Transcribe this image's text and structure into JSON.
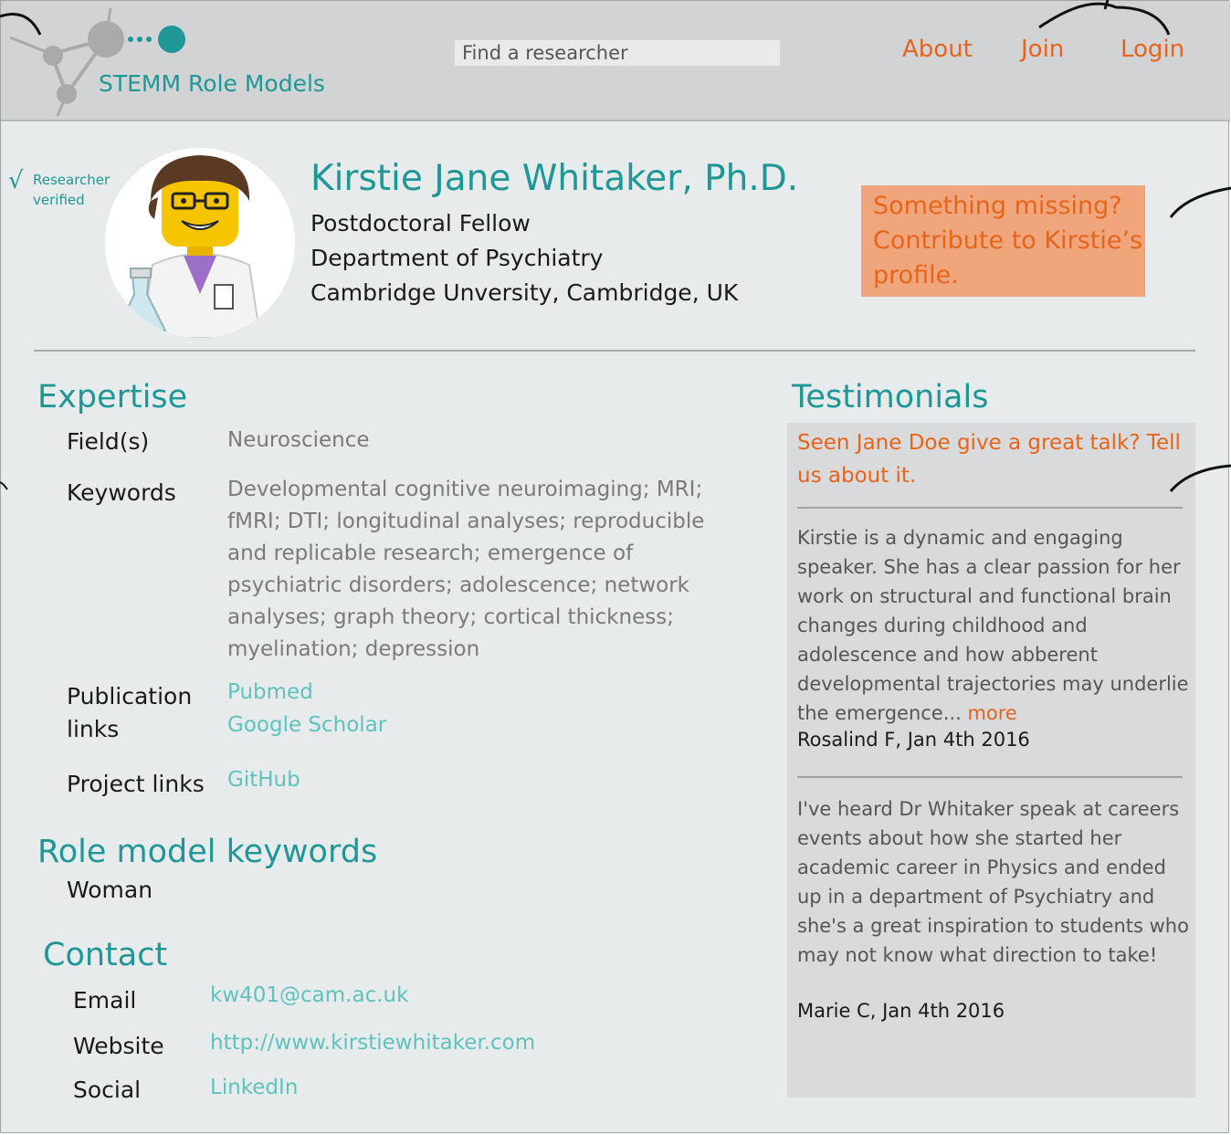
{
  "header": {
    "brand": "STEMM Role Models",
    "search_placeholder": "Find a researcher",
    "nav": {
      "about": "About",
      "join": "Join",
      "login": "Login"
    }
  },
  "profile": {
    "verified_label": "Researcher verified",
    "check_glyph": "√",
    "name": "Kirstie Jane Whitaker, Ph.D.",
    "position": "Postdoctoral Fellow",
    "department": "Department of Psychiatry",
    "institution": "Cambridge Unversity, Cambridge, UK",
    "contribute_text": "Something missing? Contribute to Kirstie’s profile."
  },
  "expertise": {
    "title": "Expertise",
    "fields_label": "Field(s)",
    "fields_value": "Neuroscience",
    "keywords_label": "Keywords",
    "keywords_value": "Developmental cognitive neuroimaging; MRI; fMRI; DTI; longitudinal analyses; reproducible and replicable research; emergence of psychiatric disorders; adolescence; network analyses; graph theory; cortical thickness; myelination; depression",
    "publication_label": "Publication links",
    "publication_links": [
      "Pubmed",
      "Google Scholar"
    ],
    "project_label": "Project links",
    "project_links": [
      "GitHub"
    ]
  },
  "role_model": {
    "title": "Role model keywords",
    "keywords": "Woman"
  },
  "contact": {
    "title": "Contact",
    "email_label": "Email",
    "email_value": "kw401@cam.ac.uk",
    "website_label": "Website",
    "website_value": "http://www.kirstiewhitaker.com",
    "social_label": "Social",
    "social_value": "LinkedIn"
  },
  "testimonials": {
    "title": "Testimonials",
    "prompt": "Seen Jane Doe give a great talk? Tell us about it.",
    "items": [
      {
        "text": "Kirstie is a dynamic and engaging speaker. She has a clear passion for her work on structural and functional brain changes during childhood and adolescence and how abberent developmental trajectories may underlie the emergence...",
        "more": "more",
        "author": "Rosalind F, Jan 4th 2016"
      },
      {
        "text": "I've heard Dr Whitaker speak at careers events about how she started her academic career in Physics and ended up in a department of Psychiatry and she's a great inspiration to students who may not know what direction to take!",
        "author": "Marie C, Jan 4th 2016"
      }
    ]
  },
  "colors": {
    "accent_teal": "#1f9797",
    "accent_orange": "#e8641b",
    "link_teal": "#5ec3be",
    "contribute_bg": "#f0a67c",
    "header_bg": "#d1d3d4",
    "panel_bg": "#d8dadb"
  },
  "icons": [
    "network-logo-icon",
    "check-icon",
    "researcher-avatar-image"
  ]
}
